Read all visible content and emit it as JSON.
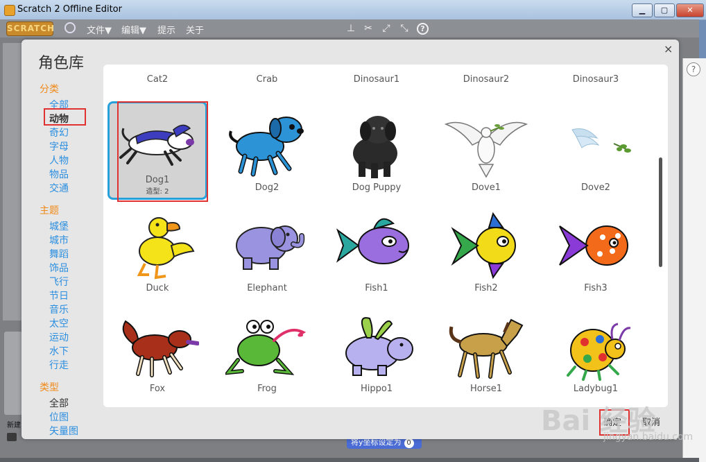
{
  "window": {
    "title": "Scratch 2 Offline Editor"
  },
  "menubar": {
    "logo": "SCRATCH",
    "items": [
      "文件▼",
      "编辑▼",
      "提示",
      "关于"
    ]
  },
  "editor": {
    "new_sprite_label": "新建",
    "block_text": "将y坐标设定为",
    "block_value": "0",
    "help": "?"
  },
  "dialog": {
    "title": "角色库",
    "close": "×",
    "categories_heading": "分类",
    "categories": [
      "全部",
      "动物",
      "奇幻",
      "字母",
      "人物",
      "物品",
      "交通"
    ],
    "selected_category": "动物",
    "themes_heading": "主题",
    "themes": [
      "城堡",
      "城市",
      "舞蹈",
      "饰品",
      "飞行",
      "节日",
      "音乐",
      "太空",
      "运动",
      "水下",
      "行走"
    ],
    "types_heading": "类型",
    "types": [
      "全部",
      "位图",
      "矢量图"
    ],
    "selected_type": "全部",
    "top_row": [
      "Cat2",
      "Crab",
      "Dinosaur1",
      "Dinosaur2",
      "Dinosaur3"
    ],
    "sprites": [
      {
        "name": "Dog1",
        "costumes": "造型: 2"
      },
      {
        "name": "Dog2"
      },
      {
        "name": "Dog Puppy"
      },
      {
        "name": "Dove1"
      },
      {
        "name": "Dove2"
      },
      {
        "name": "Duck"
      },
      {
        "name": "Elephant"
      },
      {
        "name": "Fish1"
      },
      {
        "name": "Fish2"
      },
      {
        "name": "Fish3"
      },
      {
        "name": "Fox"
      },
      {
        "name": "Frog"
      },
      {
        "name": "Hippo1"
      },
      {
        "name": "Horse1"
      },
      {
        "name": "Ladybug1"
      }
    ],
    "ok_label": "确定",
    "cancel_label": "取消"
  },
  "watermark": {
    "brand": "Bai 经验",
    "url": "jingyan.baidu.com"
  },
  "colors": {
    "category_heading": "#f08a1a",
    "category_link": "#2a8ee0",
    "selection_border": "#26a0da",
    "annotation_red": "#e03030"
  }
}
